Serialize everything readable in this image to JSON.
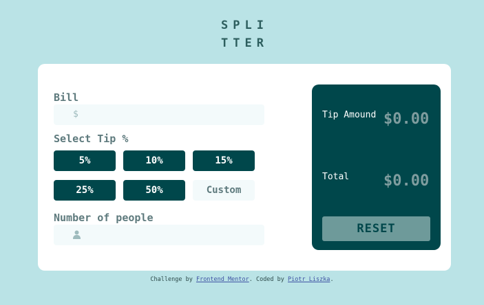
{
  "logo": {
    "line1": "SPLI",
    "line2": "TTER"
  },
  "form": {
    "bill_label": "Bill",
    "bill_icon_text": "$",
    "tip_label": "Select Tip %",
    "tips": [
      "5%",
      "10%",
      "15%",
      "25%",
      "50%"
    ],
    "custom_placeholder": "Custom",
    "people_label": "Number of people",
    "people_icon": "person-icon"
  },
  "results": {
    "tip_label": "Tip Amound",
    "tip_value": "$0.00",
    "total_label": "Total",
    "total_value": "$0.00",
    "reset_label": "RESET"
  },
  "footer": {
    "text1": "Challenge by ",
    "link1": "Frontend Mentor",
    "text2": ". Coded by ",
    "link2": "Piotr Liszka",
    "text3": "."
  },
  "colors": {
    "background": "#bae3e6",
    "dark_teal": "#00474b",
    "reset_bg": "#6e9a9a"
  }
}
